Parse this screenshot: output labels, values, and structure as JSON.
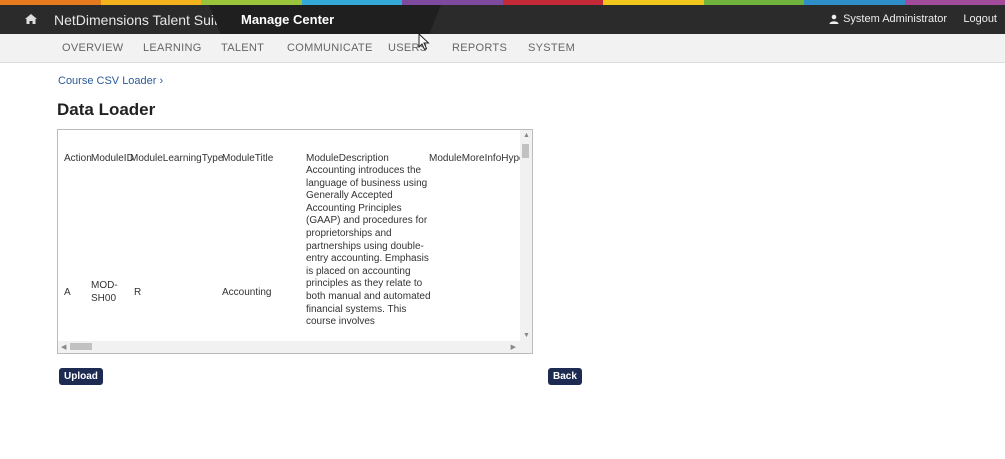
{
  "header": {
    "brand": "NetDimensions Talent Suite",
    "module": "Manage Center",
    "user": "System Administrator",
    "logout": "Logout",
    "stripe_colors": [
      "#e57a1f",
      "#f4b31c",
      "#9ac43c",
      "#33a9d9",
      "#7d4a9e",
      "#c62a39",
      "#f2c71d",
      "#6fb23e",
      "#2e8fc8",
      "#a24b9a"
    ]
  },
  "nav": {
    "items": [
      "OVERVIEW",
      "LEARNING",
      "TALENT",
      "COMMUNICATE",
      "USERS",
      "REPORTS",
      "SYSTEM"
    ]
  },
  "breadcrumb": "Course CSV Loader ›",
  "page_title": "Data Loader",
  "table": {
    "headers": [
      "Action",
      "ModuleID",
      "ModuleLearningType",
      "ModuleTitle",
      "ModuleDescription",
      "ModuleMoreInfoHype"
    ],
    "row": {
      "action": "A",
      "module_id_line1": "MOD-",
      "module_id_line2": "SH00",
      "learning_type": "R",
      "title": "Accounting",
      "description_lines": [
        "Accounting introduces the",
        "language of business using",
        "Generally Accepted",
        "Accounting Principles",
        "(GAAP) and procedures for",
        "proprietorships and",
        "partnerships using double-",
        "entry accounting. Emphasis",
        "is placed on accounting",
        "principles as they relate to",
        "both manual and automated",
        "financial systems. This",
        "course involves"
      ]
    }
  },
  "buttons": {
    "upload": "Upload",
    "back": "Back"
  }
}
